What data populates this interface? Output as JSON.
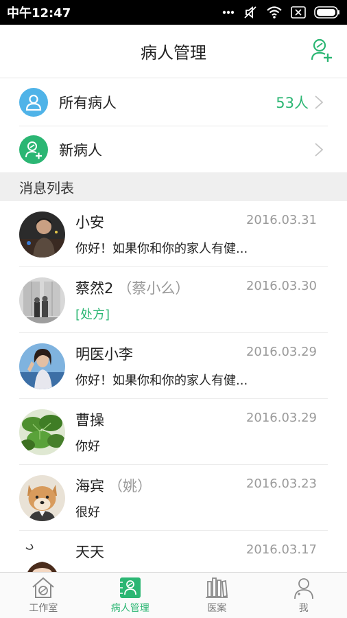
{
  "status_bar": {
    "time": "中午12:47"
  },
  "header": {
    "title": "病人管理"
  },
  "menu": {
    "all_patients": {
      "label": "所有病人",
      "count": "53人"
    },
    "new_patients": {
      "label": "新病人"
    }
  },
  "section_title": "消息列表",
  "messages": [
    {
      "name": "小安",
      "alias": "",
      "date": "2016.03.31",
      "preview": "你好！如果你和你的家人有健...",
      "preview_is_tag": false
    },
    {
      "name": "蔡然2",
      "alias": "（蔡小么）",
      "date": "2016.03.30",
      "preview": "[处方]",
      "preview_is_tag": true
    },
    {
      "name": "明医小李",
      "alias": "",
      "date": "2016.03.29",
      "preview": "你好！如果你和你的家人有健...",
      "preview_is_tag": false
    },
    {
      "name": "曹操",
      "alias": "",
      "date": "2016.03.29",
      "preview": "你好",
      "preview_is_tag": false
    },
    {
      "name": "海宾",
      "alias": "（姚）",
      "date": "2016.03.23",
      "preview": "很好",
      "preview_is_tag": false
    },
    {
      "name": "天天",
      "alias": "",
      "date": "2016.03.17",
      "preview": "",
      "preview_is_tag": false
    }
  ],
  "tabs": [
    {
      "label": "工作室",
      "icon": "studio-icon",
      "active": false
    },
    {
      "label": "病人管理",
      "icon": "patient-management-icon",
      "active": true
    },
    {
      "label": "医案",
      "icon": "medical-records-icon",
      "active": false
    },
    {
      "label": "我",
      "icon": "profile-icon",
      "active": false
    }
  ],
  "colors": {
    "accent": "#2bb673",
    "blue": "#4fb3e8",
    "header_bg": "#ffffff",
    "section_bg": "#efefef"
  }
}
